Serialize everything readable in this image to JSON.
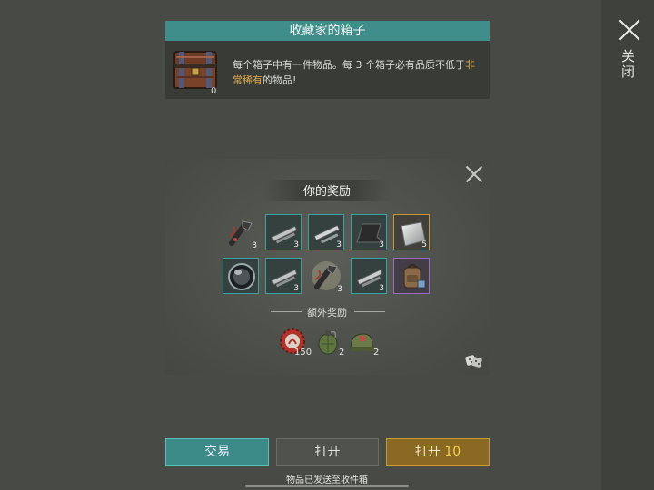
{
  "close": {
    "label": "关闭"
  },
  "chest": {
    "title": "收藏家的箱子",
    "count": "0",
    "desc_part1": "每个箱子中有一件物品。每 3 个箱子必有品质不低于",
    "desc_highlight": "非常稀有",
    "desc_part2": "的物品!"
  },
  "reward": {
    "title": "你的奖励",
    "slots": [
      {
        "icon": "pipe-wrench-icon",
        "qty": "3",
        "rarity": "plain"
      },
      {
        "icon": "metal-pipe-icon",
        "qty": "3",
        "rarity": "teal"
      },
      {
        "icon": "metal-pipe-icon",
        "qty": "3",
        "rarity": "teal"
      },
      {
        "icon": "rubber-sheet-icon",
        "qty": "3",
        "rarity": "teal"
      },
      {
        "icon": "steel-plate-icon",
        "qty": "5",
        "rarity": "gold"
      },
      {
        "icon": "lens-icon",
        "qty": "",
        "rarity": "teal"
      },
      {
        "icon": "metal-pipe-icon",
        "qty": "3",
        "rarity": "teal"
      },
      {
        "icon": "pipe-wrench-icon",
        "qty": "3",
        "rarity": "plain"
      },
      {
        "icon": "metal-pipe-icon",
        "qty": "3",
        "rarity": "teal"
      },
      {
        "icon": "backpack-icon",
        "qty": "",
        "rarity": "purple"
      }
    ],
    "bonus_label": "额外奖励",
    "bonus": [
      {
        "icon": "bottle-cap-icon",
        "qty": "150"
      },
      {
        "icon": "grenade-icon",
        "qty": "2"
      },
      {
        "icon": "helmet-icon",
        "qty": "2"
      }
    ]
  },
  "buttons": {
    "trade": "交易",
    "open": "打开",
    "open10_label": "打开",
    "open10_num": "10"
  },
  "footer": {
    "note": "物品已发送至收件箱"
  },
  "colors": {
    "teal": "#3f8e8b",
    "gold": "#c9962f",
    "purple": "#9b6bc4",
    "highlight": "#e0a94a"
  }
}
